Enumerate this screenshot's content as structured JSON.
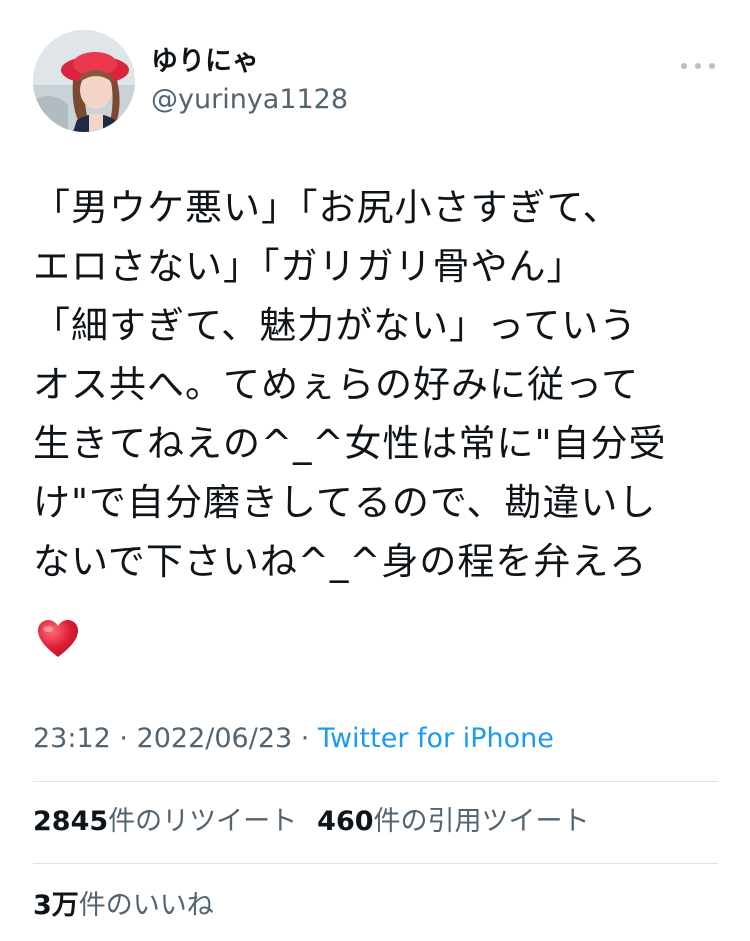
{
  "user": {
    "display_name": "ゆりにゃ",
    "handle": "@yurinya1128"
  },
  "tweet": {
    "lines": [
      "「男ウケ悪い」「お尻小さすぎて、",
      "エロさない」「ガリガリ骨やん」",
      "「細すぎて、魅力がない」っていう",
      "オス共へ。てめぇらの好みに従って",
      "生きてねえの^_^女性は常に\"自分受",
      "け\"で自分磨きしてるので、勘違いし",
      "ないで下さいね^_^身の程を弁えろ"
    ],
    "emoji": "heart-emoji"
  },
  "meta": {
    "time": "23:12",
    "separator1": " · ",
    "date": "2022/06/23",
    "separator2": " · ",
    "source": "Twitter for iPhone"
  },
  "stats": {
    "retweets_count": "2845",
    "retweets_label": "件のリツイート",
    "quotes_count": "460",
    "quotes_label": "件の引用ツイート",
    "likes_count": "3万",
    "likes_label": "件のいいね"
  },
  "colors": {
    "text": "#0f1419",
    "secondary": "#536471",
    "link": "#1d9bf0",
    "divider": "#dfe3e6",
    "heart": "#e0245e"
  }
}
